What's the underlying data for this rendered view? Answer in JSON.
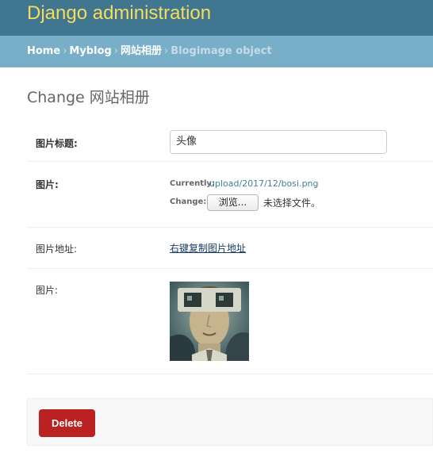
{
  "header": {
    "site_name": "Django administration"
  },
  "breadcrumbs": {
    "home": "Home",
    "app": "Myblog",
    "model": "网站相册",
    "current": "Blogimage object",
    "separator": "›"
  },
  "page": {
    "title": "Change 网站相册"
  },
  "form": {
    "title_field": {
      "label": "图片标题:",
      "value": "头像"
    },
    "image_field": {
      "label": "图片:",
      "currently_label": "Currently:",
      "currently_value": "upload/2017/12/bosi.png",
      "change_label": "Change:",
      "browse_label": "浏览...",
      "no_file_text": "未选择文件。"
    },
    "url_field": {
      "label": "图片地址:",
      "link_text": "右键复制图片地址"
    },
    "preview_field": {
      "label": "图片:"
    }
  },
  "actions": {
    "delete_label": "Delete"
  },
  "colors": {
    "header_bg": "#417690",
    "brand_text": "#f5dd5d",
    "breadcrumbs_bg": "#79aec8",
    "delete_bg": "#ba2121",
    "link": "#447e9b"
  }
}
